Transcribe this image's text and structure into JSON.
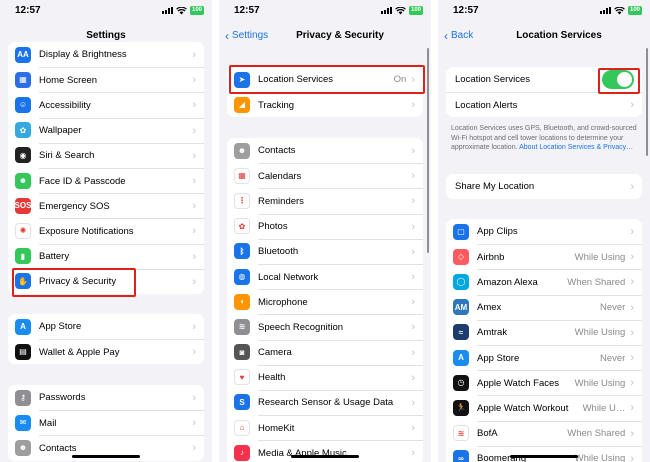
{
  "status": {
    "time": "12:57",
    "battery": "100"
  },
  "panel1": {
    "title": "Settings",
    "group1": [
      {
        "label": "Display & Brightness",
        "icon": "brightness-icon",
        "color": "#1a73e8",
        "glyph": "AA"
      },
      {
        "label": "Home Screen",
        "icon": "home-screen-icon",
        "color": "#2c6ee8",
        "glyph": "▦"
      },
      {
        "label": "Accessibility",
        "icon": "accessibility-icon",
        "color": "#1a73e8",
        "glyph": "☺"
      },
      {
        "label": "Wallpaper",
        "icon": "wallpaper-icon",
        "color": "#33a9e0",
        "glyph": "✿"
      },
      {
        "label": "Siri & Search",
        "icon": "siri-icon",
        "color": "#222222",
        "glyph": "◉"
      },
      {
        "label": "Face ID & Passcode",
        "icon": "face-id-icon",
        "color": "#34c759",
        "glyph": "☻"
      },
      {
        "label": "Emergency SOS",
        "icon": "sos-icon",
        "color": "#e53935",
        "glyph": "SOS"
      },
      {
        "label": "Exposure Notifications",
        "icon": "exposure-icon",
        "color": "#ffffff",
        "glyph": "✺"
      },
      {
        "label": "Battery",
        "icon": "battery-icon",
        "color": "#34c759",
        "glyph": "▮"
      },
      {
        "label": "Privacy & Security",
        "icon": "hand-icon",
        "color": "#1a73e8",
        "glyph": "✋"
      }
    ],
    "group2": [
      {
        "label": "App Store",
        "icon": "app-store-icon",
        "color": "#1a8cf0",
        "glyph": "A"
      },
      {
        "label": "Wallet & Apple Pay",
        "icon": "wallet-icon",
        "color": "#111111",
        "glyph": "▤"
      }
    ],
    "group3": [
      {
        "label": "Passwords",
        "icon": "key-icon",
        "color": "#8e8e93",
        "glyph": "⚷"
      },
      {
        "label": "Mail",
        "icon": "mail-icon",
        "color": "#1a8cf0",
        "glyph": "✉"
      },
      {
        "label": "Contacts",
        "icon": "contacts-icon",
        "color": "#9e9e9e",
        "glyph": "☻"
      }
    ]
  },
  "panel2": {
    "back": "Settings",
    "title": "Privacy & Security",
    "group1": [
      {
        "label": "Location Services",
        "value": "On",
        "icon": "location-arrow-icon",
        "color": "#1a73e8",
        "glyph": "➤"
      },
      {
        "label": "Tracking",
        "value": "",
        "icon": "tracking-icon",
        "color": "#ff9500",
        "glyph": "◢"
      }
    ],
    "group2": [
      {
        "label": "Contacts",
        "icon": "contacts-icon",
        "color": "#9e9e9e",
        "glyph": "☻"
      },
      {
        "label": "Calendars",
        "icon": "calendar-icon",
        "color": "#ffffff",
        "glyph": "▦"
      },
      {
        "label": "Reminders",
        "icon": "reminders-icon",
        "color": "#ffffff",
        "glyph": "⋮"
      },
      {
        "label": "Photos",
        "icon": "photos-icon",
        "color": "#ffffff",
        "glyph": "✿"
      },
      {
        "label": "Bluetooth",
        "icon": "bluetooth-icon",
        "color": "#1a73e8",
        "glyph": "ᛒ"
      },
      {
        "label": "Local Network",
        "icon": "globe-icon",
        "color": "#1a73e8",
        "glyph": "◍"
      },
      {
        "label": "Microphone",
        "icon": "microphone-icon",
        "color": "#ff9500",
        "glyph": "◖"
      },
      {
        "label": "Speech Recognition",
        "icon": "waveform-icon",
        "color": "#8e8e93",
        "glyph": "≋"
      },
      {
        "label": "Camera",
        "icon": "camera-icon",
        "color": "#555555",
        "glyph": "◙"
      },
      {
        "label": "Health",
        "icon": "heart-icon",
        "color": "#ffffff",
        "glyph": "♥"
      },
      {
        "label": "Research Sensor & Usage Data",
        "icon": "research-icon",
        "color": "#1a73e8",
        "glyph": "S"
      },
      {
        "label": "HomeKit",
        "icon": "home-icon",
        "color": "#ffffff",
        "glyph": "⌂"
      },
      {
        "label": "Media & Apple Music",
        "icon": "music-icon",
        "color": "#f5324d",
        "glyph": "♪"
      }
    ]
  },
  "panel3": {
    "back": "Back",
    "title": "Location Services",
    "group1": [
      {
        "label": "Location Services",
        "toggle": true
      },
      {
        "label": "Location Alerts",
        "toggle": false
      }
    ],
    "description": "Location Services uses GPS, Bluetooth, and crowd-sourced Wi-Fi hotspot and cell tower locations to determine your approximate location.",
    "description_link": "About Location Services & Privacy…",
    "share_location": "Share My Location",
    "apps": [
      {
        "label": "App Clips",
        "value": "",
        "icon": "app-clips-icon",
        "color": "#1a73e8",
        "glyph": "▢"
      },
      {
        "label": "Airbnb",
        "value": "While Using",
        "icon": "airbnb-icon",
        "color": "#ff5a5f",
        "glyph": "◇"
      },
      {
        "label": "Amazon Alexa",
        "value": "When Shared",
        "icon": "alexa-icon",
        "color": "#00a8e1",
        "glyph": "◯"
      },
      {
        "label": "Amex",
        "value": "Never",
        "icon": "amex-icon",
        "color": "#2e77bc",
        "glyph": "AM"
      },
      {
        "label": "Amtrak",
        "value": "While Using",
        "icon": "amtrak-icon",
        "color": "#1d3c6e",
        "glyph": "≈"
      },
      {
        "label": "App Store",
        "value": "Never",
        "icon": "app-store-icon",
        "color": "#1a8cf0",
        "glyph": "A"
      },
      {
        "label": "Apple Watch Faces",
        "value": "While Using",
        "icon": "watch-faces-icon",
        "color": "#111111",
        "glyph": "◷"
      },
      {
        "label": "Apple Watch Workout",
        "value": "While U…",
        "icon": "workout-icon",
        "color": "#111111",
        "glyph": "🏃"
      },
      {
        "label": "BofA",
        "value": "When Shared",
        "icon": "bofa-icon",
        "color": "#ffffff",
        "glyph": "≋"
      },
      {
        "label": "Boomerang",
        "value": "While Using",
        "icon": "boomerang-icon",
        "color": "#1a73e8",
        "glyph": "∞"
      }
    ]
  }
}
